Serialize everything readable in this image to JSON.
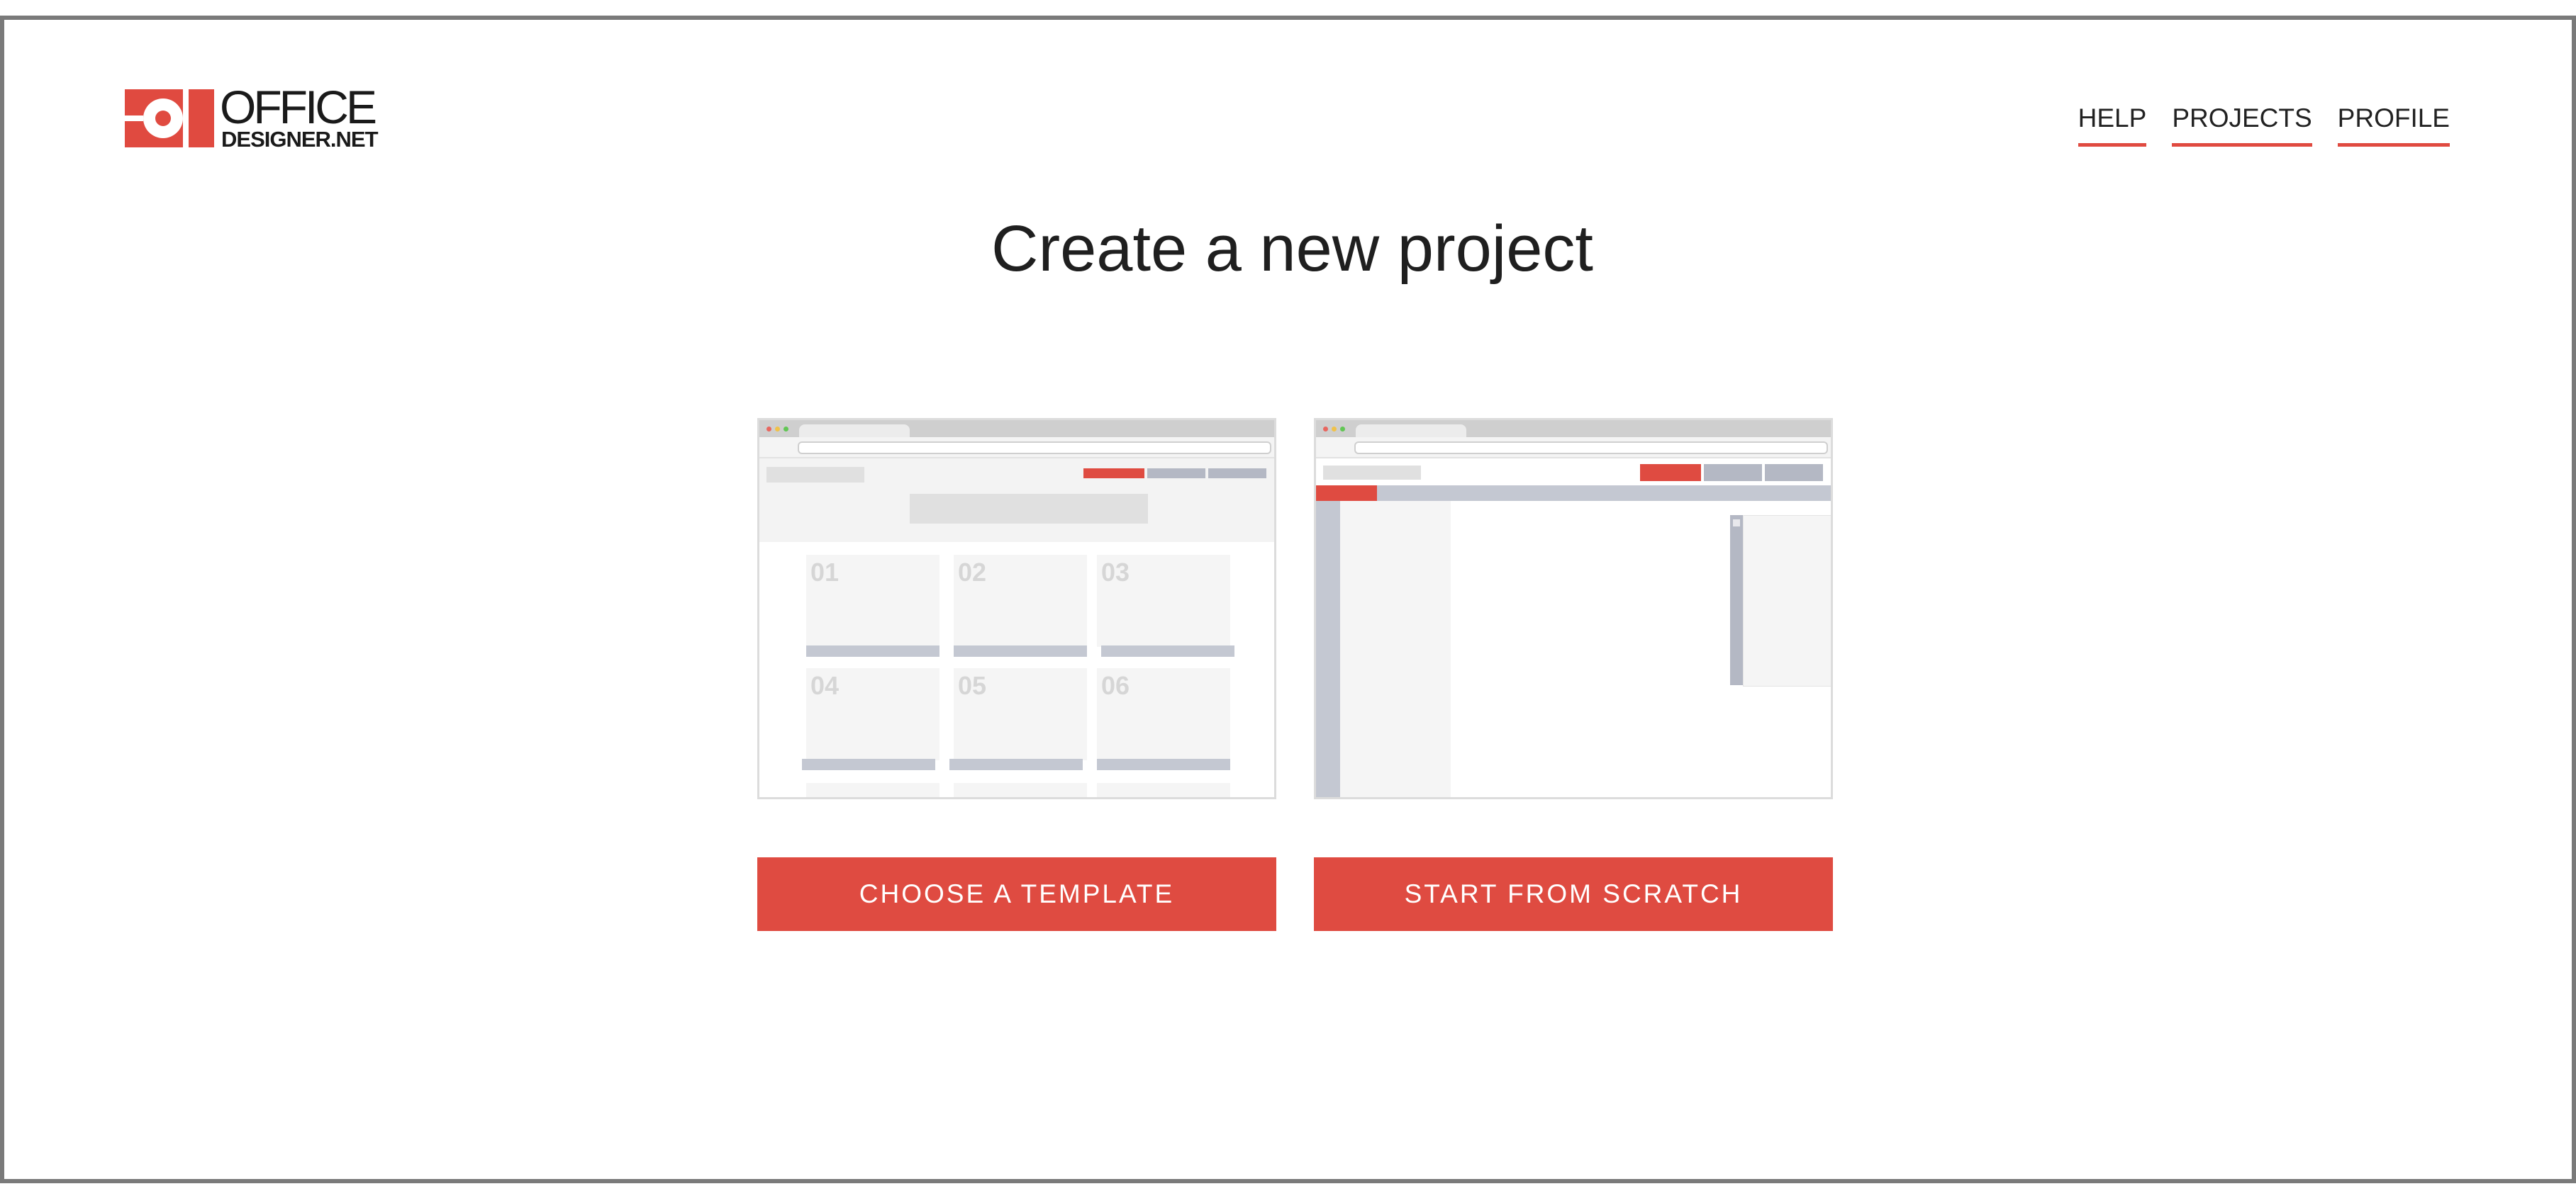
{
  "brand": {
    "line1": "OFFICE",
    "line2": "DESIGNER.NET",
    "accent_color": "#e04a40"
  },
  "nav": {
    "items": [
      {
        "label": "HELP"
      },
      {
        "label": "PROJECTS"
      },
      {
        "label": "PROFILE"
      }
    ]
  },
  "main": {
    "title": "Create a new project",
    "template_preview": {
      "tiles": [
        "01",
        "02",
        "03",
        "04",
        "05",
        "06"
      ]
    },
    "choose_template_label": "CHOOSE A TEMPLATE",
    "start_scratch_label": "START FROM SCRATCH"
  }
}
